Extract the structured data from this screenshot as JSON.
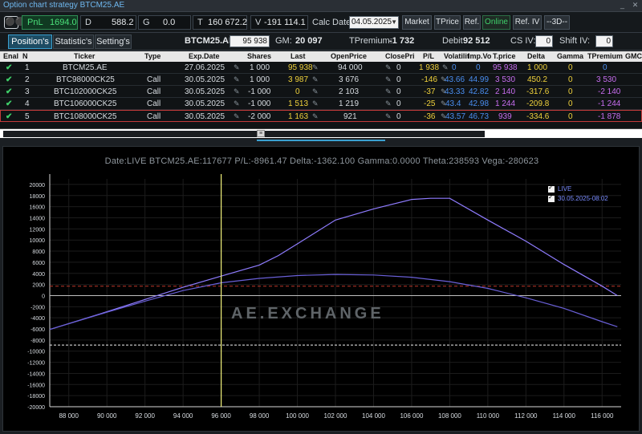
{
  "window": {
    "title": "Option chart strategy BTCM25.AE"
  },
  "top_stats": {
    "pnl_label": "PnL",
    "pnl_value": "1694.0",
    "d_label": "D",
    "d_value": "588.2",
    "g_label": "G",
    "g_value": "0.0",
    "t_label": "T",
    "t_value": "160 672.2",
    "v_label": "V",
    "v_value": "-191 114.1",
    "calc_date_label": "Calc Date:",
    "calc_date_value": "04.05.2025",
    "buttons": [
      "Market",
      "TPrice",
      "Ref.",
      "Online",
      "Ref. IV",
      "--3D--"
    ]
  },
  "tabs": [
    "Position's",
    "Statistic's",
    "Setting's"
  ],
  "summary": {
    "ticker": "BTCM25.AE",
    "price": "95 938",
    "gm_label": "GM:",
    "gm_value": "20 097",
    "tpremium_label": "TPremium:",
    "tpremium_value": "-1 732",
    "debit_label": "Debit",
    "debit_value": "92 512",
    "cs_iv_label": "CS IV:",
    "cs_iv_value": "0",
    "shift_iv_label": "Shift IV:",
    "shift_iv_value": "0"
  },
  "table": {
    "headers": [
      "Enal",
      "N",
      "Ticker",
      "Type",
      "Exp.Date",
      "Shares",
      "Last",
      "OpenPrice",
      "ClosePri",
      "P/L",
      "Volatilit",
      "Imp.Vo",
      "T.price",
      "Delta",
      "Gamma",
      "TPremium",
      "GMCF"
    ],
    "rows": [
      {
        "n": "1",
        "ticker": "BTCM25.AE",
        "type": "",
        "exp": "27.06.2025",
        "shares": "1 000",
        "last": "95 938",
        "open": "94 000",
        "close": "0",
        "pl": "1 938",
        "vol": "0",
        "iv": "0",
        "tprice": "95 938",
        "delta": "1 000",
        "gamma": "0",
        "tprem": "0"
      },
      {
        "n": "2",
        "ticker": "BTC98000CK25",
        "type": "Call",
        "exp": "30.05.2025",
        "shares": "1 000",
        "last": "3 987",
        "open": "3 676",
        "close": "0",
        "pl": "-146",
        "vol": "43.66",
        "iv": "44.99",
        "tprice": "3 530",
        "delta": "450.2",
        "gamma": "0",
        "tprem": "3 530"
      },
      {
        "n": "3",
        "ticker": "BTC102000CK25",
        "type": "Call",
        "exp": "30.05.2025",
        "shares": "-1 000",
        "last": "0",
        "open": "2 103",
        "close": "0",
        "pl": "-37",
        "vol": "43.33",
        "iv": "42.82",
        "tprice": "2 140",
        "delta": "-317.6",
        "gamma": "0",
        "tprem": "-2 140"
      },
      {
        "n": "4",
        "ticker": "BTC106000CK25",
        "type": "Call",
        "exp": "30.05.2025",
        "shares": "-1 000",
        "last": "1 513",
        "open": "1 219",
        "close": "0",
        "pl": "-25",
        "vol": "43.4",
        "iv": "42.98",
        "tprice": "1 244",
        "delta": "-209.8",
        "gamma": "0",
        "tprem": "-1 244"
      },
      {
        "n": "5",
        "ticker": "BTC108000CK25",
        "type": "Call",
        "exp": "30.05.2025",
        "shares": "-2 000",
        "last": "1 163",
        "open": "921",
        "close": "0",
        "pl": "-36",
        "vol": "43.57",
        "iv": "46.73",
        "tprice": "939",
        "delta": "-334.6",
        "gamma": "0",
        "tprem": "-1 878"
      }
    ]
  },
  "chart_data": {
    "type": "line",
    "title": "Date:LIVE  BTCM25.AE:117677  P/L:-8961.47  Delta:-1362.100  Gamma:0.0000  Theta:238593  Vega:-280623",
    "watermark": "AE.EXCHANGE",
    "xlim": [
      87000,
      117000
    ],
    "ylim": [
      -20000,
      21000
    ],
    "x_ticks": [
      88000,
      90000,
      92000,
      94000,
      96000,
      98000,
      100000,
      102000,
      104000,
      106000,
      108000,
      110000,
      112000,
      114000,
      116000
    ],
    "y_ticks": [
      -20000,
      -18000,
      -16000,
      -14000,
      -12000,
      -10000,
      -8000,
      -6000,
      -4000,
      -2000,
      0,
      2000,
      4000,
      6000,
      8000,
      10000,
      12000,
      14000,
      16000,
      18000,
      20000
    ],
    "current_price": 96000,
    "ref_levels": {
      "red_dashed": 1700,
      "white_dashed": -8900
    },
    "series": [
      {
        "name": "LIVE",
        "x": [
          87000,
          90000,
          92000,
          94000,
          96000,
          98000,
          99000,
          100000,
          102000,
          104000,
          106000,
          107000,
          108000,
          110000,
          112000,
          114000,
          116000,
          116800
        ],
        "y": [
          -6100,
          -2900,
          -700,
          1500,
          3500,
          5500,
          7200,
          9300,
          13600,
          15600,
          17300,
          17500,
          17500,
          13600,
          9800,
          5600,
          1700,
          0
        ]
      },
      {
        "name": "30.05.2025-08:02",
        "x": [
          87000,
          90000,
          92000,
          94000,
          96000,
          98000,
          100000,
          102000,
          104000,
          106000,
          108000,
          110000,
          112000,
          114000,
          116000,
          116800
        ],
        "y": [
          -6100,
          -3000,
          -1000,
          900,
          2300,
          3100,
          3600,
          3800,
          3700,
          3300,
          2500,
          1300,
          -400,
          -2300,
          -4700,
          -5600
        ]
      }
    ],
    "colors": {
      "live": "#8f7cff",
      "expiry": "#6a60d8",
      "cursor": "#f2f27a",
      "red_level": "#c0392b",
      "white_level": "#eeeeee"
    }
  }
}
